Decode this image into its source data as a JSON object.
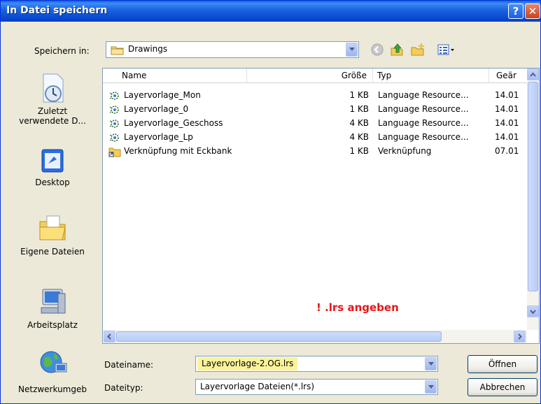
{
  "window": {
    "title": "In Datei speichern",
    "help_glyph": "?",
    "close_glyph": "✕"
  },
  "save_in": {
    "label": "Speichern in:",
    "value": "Drawings"
  },
  "places": [
    {
      "label": "Zuletzt\nverwendete D...",
      "icon": "recent-documents-icon"
    },
    {
      "label": "Desktop",
      "icon": "desktop-icon"
    },
    {
      "label": "Eigene Dateien",
      "icon": "my-documents-icon"
    },
    {
      "label": "Arbeitsplatz",
      "icon": "my-computer-icon"
    },
    {
      "label": "Netzwerkumgeb",
      "icon": "network-icon"
    }
  ],
  "columns": {
    "name": "Name",
    "size": "Größe",
    "type": "Typ",
    "changed": "Geär"
  },
  "files": [
    {
      "name": "Layervorlage_Mon",
      "size": "1 KB",
      "type": "Language Resource...",
      "date": "14.01",
      "icon": "lrs-file-icon"
    },
    {
      "name": "Layervorlage_0",
      "size": "1 KB",
      "type": "Language Resource...",
      "date": "14.01",
      "icon": "lrs-file-icon"
    },
    {
      "name": "Layervorlage_Geschoss",
      "size": "4 KB",
      "type": "Language Resource...",
      "date": "14.01",
      "icon": "lrs-file-icon"
    },
    {
      "name": "Layervorlage_Lp",
      "size": "4 KB",
      "type": "Language Resource...",
      "date": "14.01",
      "icon": "lrs-file-icon"
    },
    {
      "name": "Verknüpfung mit Eckbank",
      "size": "1 KB",
      "type": "Verknüpfung",
      "date": "07.01",
      "icon": "shortcut-folder-icon"
    }
  ],
  "annotation": "!  .lrs angeben",
  "filename": {
    "label": "Dateiname:",
    "value": "Layervorlage-2.OG.lrs"
  },
  "filetype": {
    "label": "Dateityp:",
    "value": "Layervorlage Dateien(*.lrs)"
  },
  "buttons": {
    "open": "Öffnen",
    "cancel": "Abbrechen"
  },
  "colors": {
    "titlebar": "#1c66e3",
    "annotation": "#e8151a",
    "filename_highlight": "#fbf39a"
  }
}
